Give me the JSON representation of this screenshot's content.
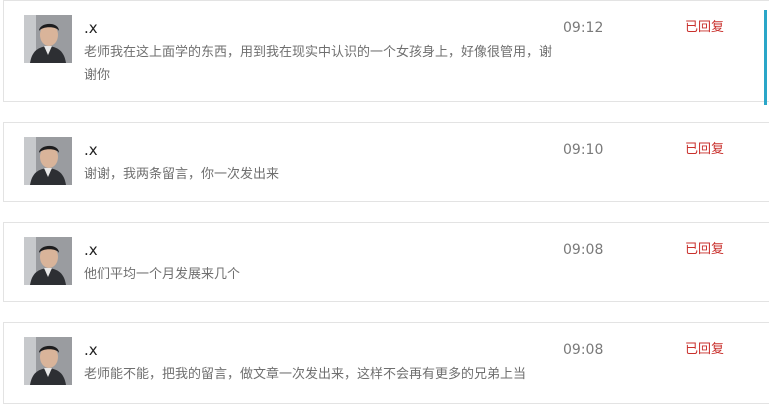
{
  "messages": [
    {
      "user": ".x",
      "time": "09:12",
      "status": "已回复",
      "text": "老师我在这上面学的东西，用到我在现实中认识的一个女孩身上，好像很管用，谢谢你"
    },
    {
      "user": ".x",
      "time": "09:10",
      "status": "已回复",
      "text": "谢谢，我两条留言，你一次发出来"
    },
    {
      "user": ".x",
      "time": "09:08",
      "status": "已回复",
      "text": "他们平均一个月发展来几个"
    },
    {
      "user": ".x",
      "time": "09:08",
      "status": "已回复",
      "text": "老师能不能，把我的留言，做文章一次发出来，这样不会再有更多的兄弟上当"
    }
  ],
  "colors": {
    "status": "#c9302c",
    "accent": "#2aa6c8"
  },
  "icons": {
    "avatar": "user-photo-avatar"
  }
}
